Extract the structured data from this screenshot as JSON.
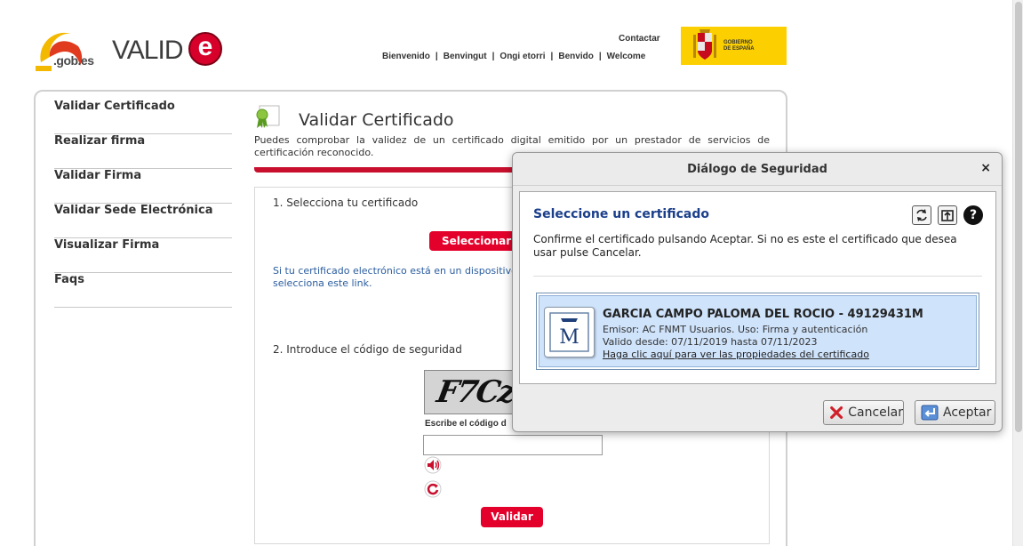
{
  "header": {
    "gob_logo_text": ".gob.es",
    "valide_text": "VALID",
    "valide_e": "e",
    "contact": "Contactar",
    "languages": [
      "Bienvenido",
      "Benvingut",
      "Ongi etorri",
      "Benvido",
      "Welcome"
    ],
    "gov_text_line1": "GOBIERNO",
    "gov_text_line2": "DE ESPAÑA"
  },
  "sidebar": {
    "items": [
      {
        "label": "Validar Certificado"
      },
      {
        "label": "Realizar firma"
      },
      {
        "label": "Validar Firma"
      },
      {
        "label": "Validar Sede Electrónica"
      },
      {
        "label": "Visualizar Firma"
      },
      {
        "label": "Faqs"
      }
    ]
  },
  "main": {
    "title": "Validar Certificado",
    "description": "Puedes comprobar la validez de un certificado digital emitido por un prestador de servicios de certificación reconocido.",
    "step1": "1. Selecciona tu certificado",
    "select_button": "Seleccionar",
    "mobile_link": "Si tu certificado electrónico está en un dispositivo selecciona este link.",
    "step2": "2. Introduce el código de seguridad",
    "captcha_text": "F7Cz",
    "captcha_label": "Escribe el código d",
    "validate_button": "Validar"
  },
  "dialog": {
    "title": "Diálogo de Seguridad",
    "close": "×",
    "heading": "Seleccione un certificado",
    "message": "Confirme el certificado pulsando Aceptar. Si no es este el certificado que desea usar pulse Cancelar.",
    "certificate": {
      "name": "GARCIA CAMPO PALOMA DEL ROCIO - 49129431M",
      "issuer": "Emisor: AC FNMT Usuarios. Uso: Firma y autenticación",
      "validity": "Valido desde: 07/11/2019 hasta 07/11/2023",
      "properties_link": "Haga clic aquí para ver las propiedades del certificado",
      "icon_letter": "M"
    },
    "help_glyph": "?",
    "cancel": "Cancelar",
    "accept": "Aceptar"
  },
  "colors": {
    "accent_red": "#e3002b",
    "dialog_heading": "#1b3f8b",
    "gov_yellow": "#fcd000",
    "cert_selected_bg": "#cfe3fb"
  }
}
